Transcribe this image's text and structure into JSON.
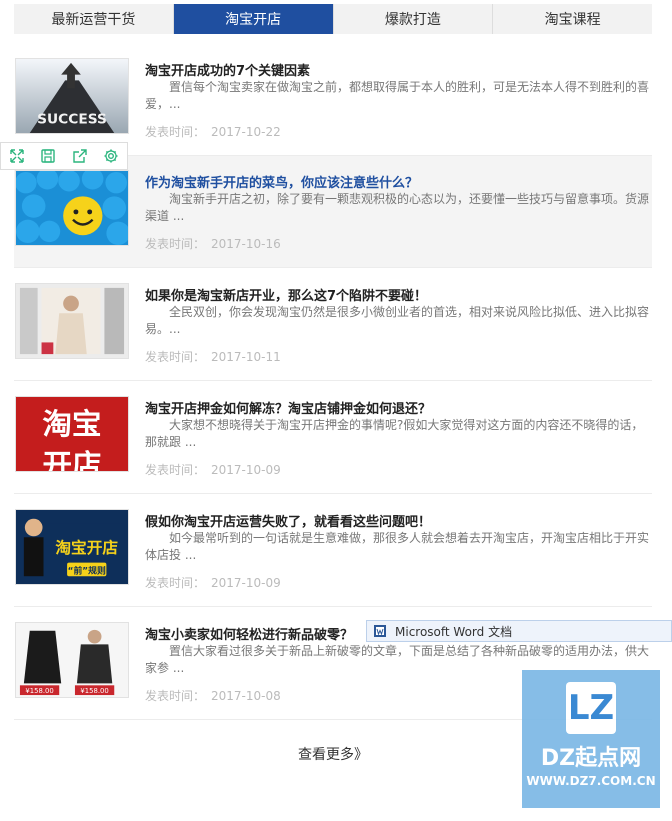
{
  "tabs": [
    {
      "label": "最新运营干货",
      "active": false
    },
    {
      "label": "淘宝开店",
      "active": true
    },
    {
      "label": "爆款打造",
      "active": false
    },
    {
      "label": "淘宝课程",
      "active": false
    }
  ],
  "date_prefix": "发表时间：",
  "articles": [
    {
      "title": "淘宝开店成功的7个关键因素",
      "summary": "置信每个淘宝卖家在做淘宝之前，都想取得属于本人的胜利，可是无法本人得不到胜利的喜爱，...",
      "date": "2017-10-22"
    },
    {
      "title": "作为淘宝新手开店的菜鸟，你应该注意些什么？",
      "summary": "淘宝新手开店之初，除了要有一颗悲观积极的心态以为，还要懂一些技巧与留意事项。货源渠道 ...",
      "date": "2017-10-16"
    },
    {
      "title": "如果你是淘宝新店开业，那么这7个陷阱不要碰！",
      "summary": "全民双创，你会发现淘宝仍然是很多小微创业者的首选，相对来说风险比拟低、进入比拟容易。...",
      "date": "2017-10-11"
    },
    {
      "title": "淘宝开店押金如何解冻？淘宝店铺押金如何退还？",
      "summary": "大家想不想晓得关于淘宝开店押金的事情呢?假如大家觉得对这方面的内容还不晓得的话，那就跟 ...",
      "date": "2017-10-09"
    },
    {
      "title": "假如你淘宝开店运营失败了，就看看这些问题吧！",
      "summary": "如今最常听到的一句话就是生意难做，那很多人就会想着去开淘宝店，开淘宝店相比于开实体店投 ...",
      "date": "2017-10-09"
    },
    {
      "title": "淘宝小卖家如何轻松进行新品破零？",
      "summary": "置信大家看过很多关于新品上新破零的文章，下面是总结了各种新品破零的适用办法，供大家参 ...",
      "date": "2017-10-08"
    }
  ],
  "thumb_text": {
    "success": "SUCCESS",
    "taobao_a": "淘宝",
    "taobao_b": "开店",
    "psy_title": "淘宝开店",
    "psy_sub": "“前”规则",
    "price_a": "¥158.00",
    "price_b": "¥158.00"
  },
  "more_label": "查看更多》",
  "word_tip": "Microsoft Word 文档",
  "watermark": {
    "logo": "LZ",
    "name": "DZ起点网",
    "url": "WWW.DZ7.COM.CN"
  },
  "colors": {
    "accent": "#1f4fa0",
    "watermark": "#7cb8e6"
  }
}
